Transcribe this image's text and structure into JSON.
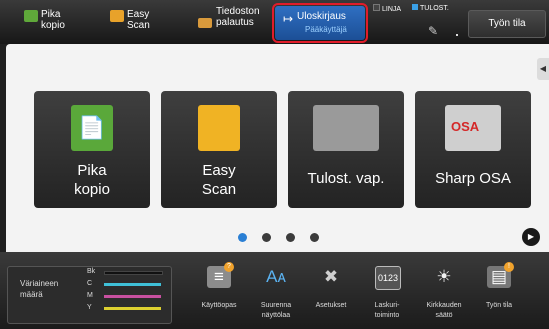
{
  "topbar": {
    "shortcuts": [
      {
        "label": "Pika\nkopio",
        "icon": "copy-icon"
      },
      {
        "label": "Easy\nScan",
        "icon": "scanner-icon"
      },
      {
        "label": "Tiedoston\npalautus",
        "icon": "folder-icon"
      }
    ],
    "logout": {
      "label": "Uloskirjaus",
      "sublabel": "Pääkäyttäjä",
      "icon": "logout-icon"
    },
    "status": {
      "line": "LINJA",
      "print": "TULOST."
    },
    "job_status_label": "Työn tila"
  },
  "main": {
    "tiles": [
      {
        "label": "Pika\nkopio",
        "icon": "copy-icon"
      },
      {
        "label": "Easy\nScan",
        "icon": "scanner-icon"
      },
      {
        "label": "Tulost. vap.",
        "icon": "printer-release-icon"
      },
      {
        "label": "Sharp OSA",
        "icon": "sharp-osa-icon",
        "logo_text": "OSA"
      }
    ],
    "pagination": {
      "pages": 4,
      "current": 1
    },
    "side_tab_icon": "collapse-arrow-icon",
    "next_icon": "play-arrow-icon"
  },
  "toner": {
    "label": "Väriaineen\nmäärä",
    "colors": [
      {
        "name": "Bk",
        "color": "#111111"
      },
      {
        "name": "C",
        "color": "#3fc0d8"
      },
      {
        "name": "M",
        "color": "#c850a0"
      },
      {
        "name": "Y",
        "color": "#dcd030"
      }
    ]
  },
  "bottom_buttons": [
    {
      "label": "Käyttöopas",
      "icon": "manual-icon"
    },
    {
      "label": "Suurenna\nnäyttölaa",
      "icon": "enlarge-display-icon"
    },
    {
      "label": "Asetukset",
      "icon": "settings-tools-icon"
    },
    {
      "label": "Laskuri-\ntoiminto",
      "icon": "counter-icon"
    },
    {
      "label": "Kirkkauden\nsäätö",
      "icon": "brightness-icon"
    },
    {
      "label": "Työn tila",
      "icon": "job-status-icon"
    }
  ],
  "accent_color": "#2a7fd4",
  "highlight_color": "#e11c2a"
}
